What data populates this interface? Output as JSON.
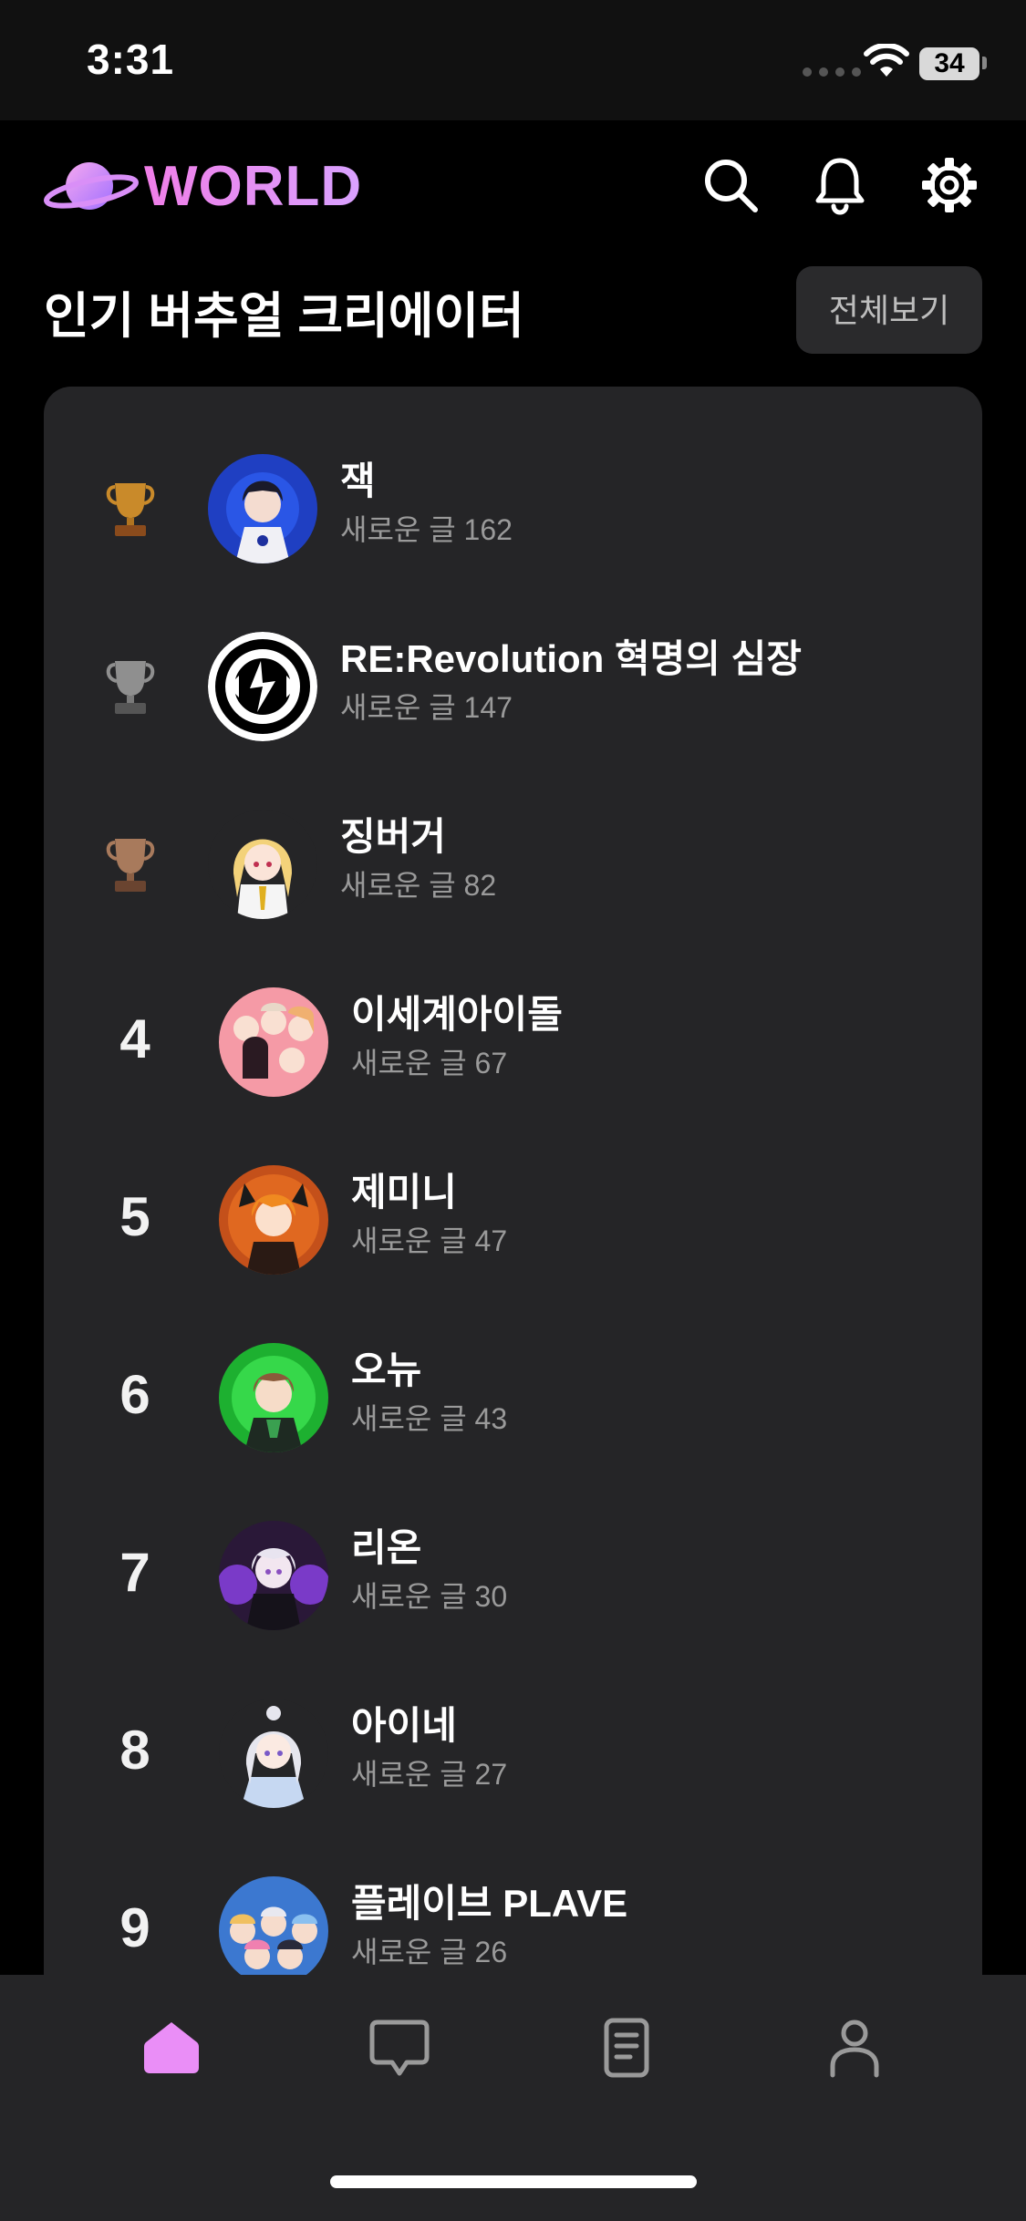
{
  "status_bar": {
    "time": "3:31",
    "battery": "34"
  },
  "header": {
    "logo_text": "WORLD",
    "icons": [
      "search-icon",
      "bell-icon",
      "gear-icon"
    ]
  },
  "section": {
    "title": "인기 버추얼 크리에이터",
    "view_all": "전체보기"
  },
  "ranking": [
    {
      "rank": "1",
      "trophy": "gold",
      "name": "잭",
      "new_posts": "새로운 글 162"
    },
    {
      "rank": "2",
      "trophy": "silver",
      "name": "RE:Revolution 혁명의 심장",
      "new_posts": "새로운 글 147"
    },
    {
      "rank": "3",
      "trophy": "bronze",
      "name": "징버거",
      "new_posts": "새로운 글 82"
    },
    {
      "rank": "4",
      "name": "이세계아이돌",
      "new_posts": "새로운 글 67"
    },
    {
      "rank": "5",
      "name": "제미니",
      "new_posts": "새로운 글 47"
    },
    {
      "rank": "6",
      "name": "오뉴",
      "new_posts": "새로운 글 43"
    },
    {
      "rank": "7",
      "name": "리온",
      "new_posts": "새로운 글 30"
    },
    {
      "rank": "8",
      "name": "아이네",
      "new_posts": "새로운 글 27"
    },
    {
      "rank": "9",
      "name": "플레이브 PLAVE",
      "new_posts": "새로운 글 26"
    }
  ],
  "bottom_nav": {
    "items": [
      "home-icon",
      "chat-icon",
      "document-icon",
      "profile-icon"
    ],
    "active": "home-icon"
  },
  "colors": {
    "accent": "#ea8ef7",
    "card_bg": "#252527",
    "gold": "#c98a2a",
    "silver": "#8f8f8f",
    "bronze": "#a87a5c"
  }
}
